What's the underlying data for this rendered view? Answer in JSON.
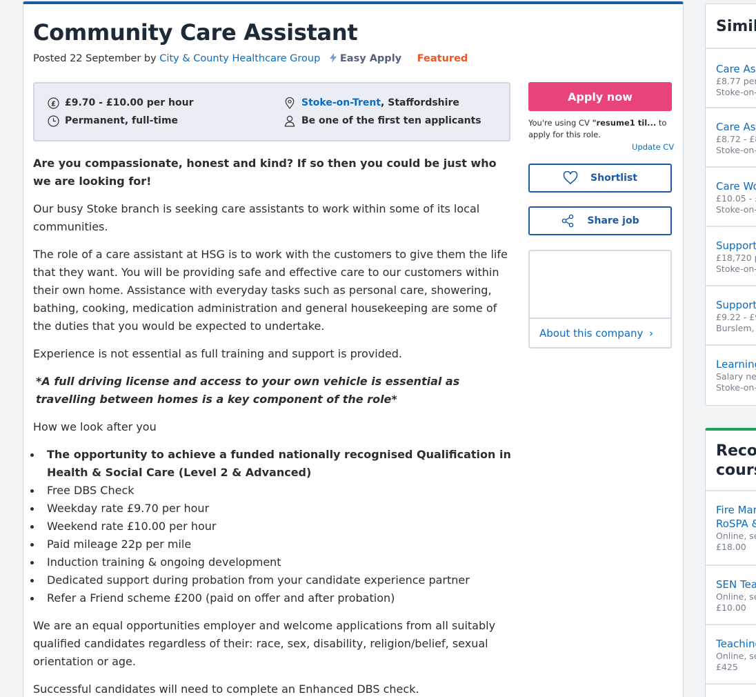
{
  "job": {
    "title": "Community Care Assistant",
    "posted_prefix": "Posted 22 September by",
    "company": "City & County Healthcare Group",
    "easy_apply": "Easy Apply",
    "featured": "Featured"
  },
  "summary": {
    "salary": "£9.70 - £10.00 per hour",
    "job_type": "Permanent, full-time",
    "location_link": "Stoke-on-Trent",
    "location_rest": ", Staffordshire",
    "applicants": "Be one of the first ten applicants"
  },
  "description": {
    "intro": "Are you compassionate, honest and kind? If so then you could be just who we are looking for!",
    "p1": "Our busy Stoke branch is seeking care assistants to work within some of its local communities.",
    "p2": "The role of a care assistant at HSG is to work with the customers to give them the life that they want. You will be providing safe and effective care to our customers within their own home. Assistance with everyday tasks such as personal care, showering, bathing, cooking, medication administration and general housekeeping are some of the duties that you would be expected to undertake.",
    "p3": "Experience is not essential as full training and support is provided.",
    "license": "*A full driving license and access to your own vehicle is essential as travelling between homes is a key component of the role*",
    "benefits_heading": "How we look after you",
    "benefits": [
      "The opportunity to achieve a funded nationally recognised Qualification in Health & Social Care (Level 2 & Advanced)",
      "Free DBS Check",
      "Weekday rate £9.70 per hour",
      "Weekend rate £10.00 per hour",
      "Paid mileage 22p per mile",
      "Induction training & ongoing development",
      "Dedicated support during probation from your candidate experience partner",
      "Refer a Friend scheme £200 (paid on offer and after probation)"
    ],
    "p4": "We are an equal opportunities employer and welcome applications from all suitably qualified candidates regardless of their: race, sex, disability, religion/belief, sexual orientation or age.",
    "p5": "Successful candidates will need to complete an Enhanced DBS check."
  },
  "actions": {
    "apply": "Apply now",
    "cv_prefix": "You're using CV",
    "cv_name": "\"resume1 til...",
    "cv_suffix": "to apply for this role.",
    "update_cv": "Update CV",
    "shortlist": "Shortlist",
    "share": "Share job",
    "about_company": "About this company",
    "about_chevron": "›"
  },
  "similar_jobs": {
    "heading": "Simil",
    "items": [
      {
        "title": "Care Ass",
        "salary": "£8.77 per",
        "location": "Stoke-on-"
      },
      {
        "title": "Care Ass",
        "salary": "£8.72 - £8",
        "location": "Stoke-on-"
      },
      {
        "title": "Care Wo",
        "salary": "£10.05 - £",
        "location": "Stoke-on-"
      },
      {
        "title": "Support",
        "salary": "£18,720 p",
        "location": "Stoke-on-"
      },
      {
        "title": "Support",
        "salary": "£9.22 - £9",
        "location": "Burslem,"
      },
      {
        "title": "Learning",
        "salary": "Salary neg",
        "location": "Stoke-on-"
      }
    ]
  },
  "courses": {
    "heading_line1": "Reco",
    "heading_line2": "cours",
    "items": [
      {
        "title1": "Fire Mar",
        "title2": "RoSPA &",
        "meta": "Online, se",
        "price": "£18.00"
      },
      {
        "title1": "SEN Tea",
        "title2": "",
        "meta": "Online, se",
        "price": "£10.00"
      },
      {
        "title1": "Teaching",
        "title2": "",
        "meta": "Online, se",
        "price": "£425"
      }
    ]
  },
  "colors": {
    "apply_button": "#e8437d",
    "primary_blue": "#1c5aa6",
    "link_blue": "#0a6cc2",
    "featured": "#f05423",
    "courses_accent": "#1aa35a"
  }
}
